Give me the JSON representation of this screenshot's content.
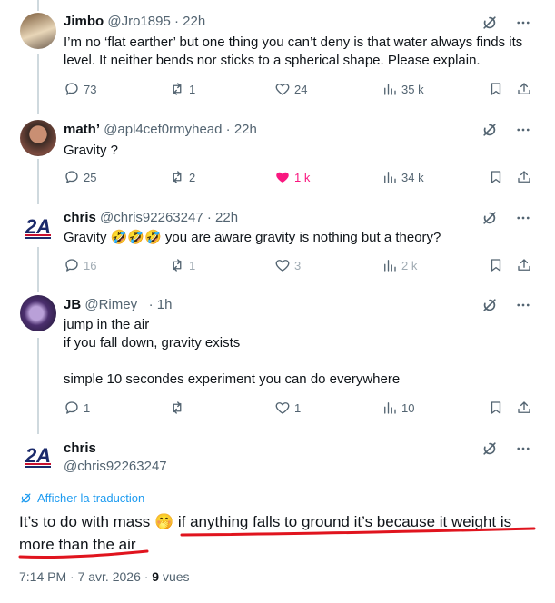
{
  "tweets": [
    {
      "name": "Jimbo",
      "handle": "@Jro1895",
      "time": "· 22h",
      "text": "I’m no ‘flat earther’ but one thing you can’t deny is that water always finds its level. It neither bends nor sticks to a spherical shape. Please explain.",
      "replies": "73",
      "reposts": "1",
      "likes": "24",
      "views": "35 k"
    },
    {
      "name": "math’",
      "handle": "@apl4cef0rmyhead",
      "time": "· 22h",
      "text": "Gravity ?",
      "replies": "25",
      "reposts": "2",
      "likes": "1 k",
      "views": "34 k",
      "liked": true
    },
    {
      "name": "chris",
      "handle": "@chris92263247",
      "time": "· 22h",
      "text_before": "Gravity ",
      "emoji": "🤣🤣🤣",
      "text_after": " you are aware gravity is nothing but a theory?",
      "replies": "16",
      "reposts": "1",
      "likes": "3",
      "views": "2 k"
    },
    {
      "name": "JB",
      "handle": "@Rimey_",
      "time": "· 1h",
      "lines": [
        "jump in the air",
        "if you fall down, gravity exists",
        "",
        "simple 10 secondes experiment you can do everywhere"
      ],
      "replies": "1",
      "reposts": "",
      "likes": "1",
      "views": "10"
    }
  ],
  "main": {
    "name": "chris",
    "handle": "@chris92263247",
    "translate_label": "Afficher la traduction",
    "text_part1": "It’s to do with mass ",
    "emoji": "🤭",
    "text_part2": " if anything falls to ground it’s because it weight is more than the air",
    "time": "7:14 PM · 7 avr. 2026 · ",
    "views_count": "9",
    "views_label": " vues"
  },
  "avatar_2a_text": "2A",
  "icons": [
    "grok-icon",
    "more-icon",
    "reply-icon",
    "repost-icon",
    "like-icon",
    "views-icon",
    "bookmark-icon",
    "share-icon",
    "translate-icon"
  ],
  "colors": {
    "accent": "#1d9bf0",
    "like": "#f91880",
    "muted": "#536471",
    "underline": "#e0141e",
    "thread_line": "#cfd9de"
  }
}
